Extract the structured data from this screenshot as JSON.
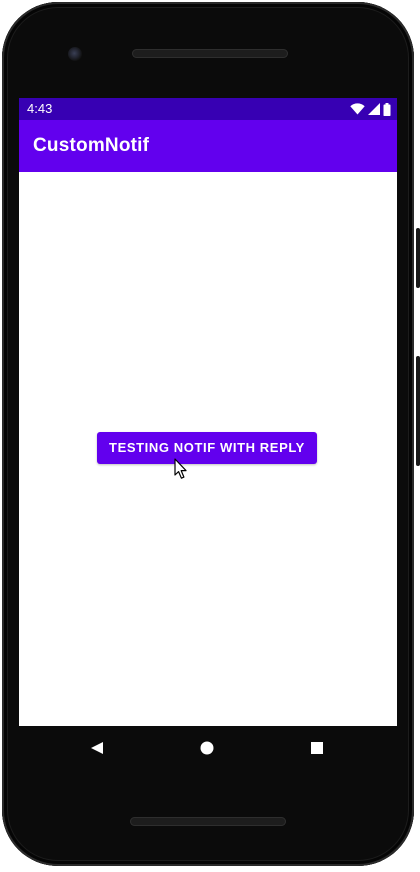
{
  "status_bar": {
    "time": "4:43",
    "icons": [
      "wifi-icon",
      "cell-signal-icon",
      "battery-icon"
    ]
  },
  "app_bar": {
    "title": "CustomNotif"
  },
  "main": {
    "button_label": "TESTING NOTIF WITH REPLY"
  },
  "nav_bar": {
    "icons": [
      "back-icon",
      "home-icon",
      "recents-icon"
    ]
  },
  "colors": {
    "status_bar": "#3700b3",
    "primary": "#6200ee",
    "on_primary": "#ffffff",
    "background": "#ffffff",
    "device_frame": "#0b0b0b"
  }
}
